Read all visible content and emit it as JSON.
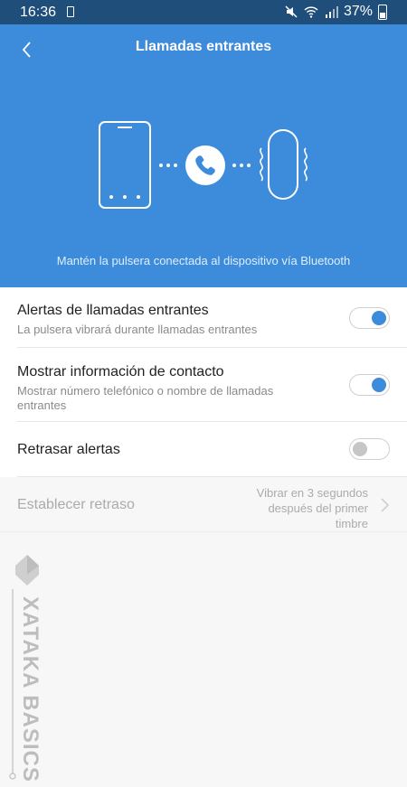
{
  "status_bar": {
    "time": "16:36",
    "battery": "37%"
  },
  "header": {
    "title": "Llamadas entrantes",
    "back_icon": "chevron-left-icon",
    "color": "#3d8bdb"
  },
  "illustration": {
    "icons": [
      "phone-device-icon",
      "call-icon",
      "band-icon"
    ]
  },
  "hint": "Mantén la pulsera conectada al dispositivo vía Bluetooth",
  "settings": [
    {
      "label": "Alertas de llamadas entrantes",
      "sub": "La pulsera vibrará durante llamadas entrantes",
      "enabled": true
    },
    {
      "label": "Mostrar información de contacto",
      "sub": "Mostrar número telefónico o nombre de llamadas entrantes",
      "enabled": true
    },
    {
      "label": "Retrasar alertas",
      "enabled": false
    }
  ],
  "delay": {
    "label": "Establecer retraso",
    "value_line1": "Vibrar en 3 segundos",
    "value_line2": "después del primer",
    "value_line3": "timbre"
  },
  "watermark": {
    "text": "XATAKA BASICS"
  }
}
